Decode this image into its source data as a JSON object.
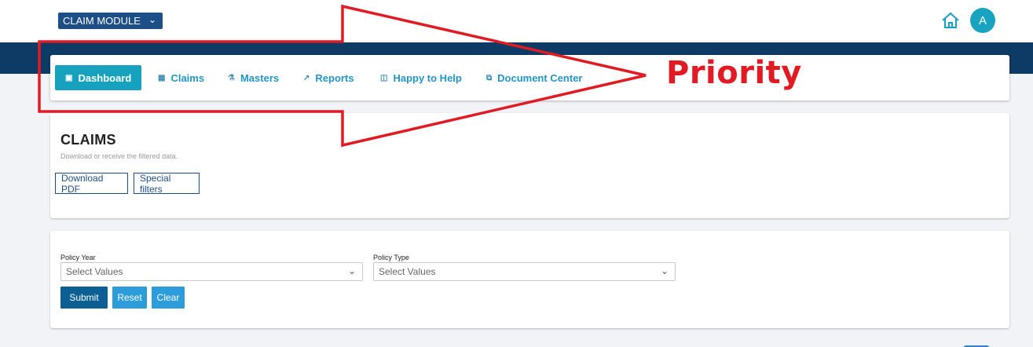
{
  "topbar": {
    "module_label": "CLAIM MODULE",
    "avatar_letter": "A"
  },
  "nav": {
    "tabs": [
      {
        "label": "Dashboard",
        "icon": "monitor-icon",
        "active": true
      },
      {
        "label": "Claims",
        "icon": "grid-icon",
        "active": false
      },
      {
        "label": "Masters",
        "icon": "sitemap-icon",
        "active": false
      },
      {
        "label": "Reports",
        "icon": "chart-line-icon",
        "active": false
      },
      {
        "label": "Happy to Help",
        "icon": "map-icon",
        "active": false
      },
      {
        "label": "Document Center",
        "icon": "copy-icon",
        "active": false
      }
    ]
  },
  "claims_panel": {
    "title": "CLAIMS",
    "subtitle": "Download or receive the filtered data.",
    "download_label": "Download PDF",
    "special_label": "Special filters"
  },
  "filters": {
    "policy_year_label": "Policy Year",
    "policy_year_value": "Select Values",
    "policy_type_label": "Policy Type",
    "policy_type_value": "Select Values",
    "submit_label": "Submit",
    "reset_label": "Reset",
    "clear_label": "Clear"
  },
  "annotation": {
    "text": "Priority",
    "color": "#e01b24"
  },
  "colors": {
    "brand_navy": "#0e3a66",
    "accent_teal": "#16a2bf",
    "link_blue": "#2196c9",
    "submit_blue": "#0b5f95",
    "secondary_blue": "#2d9cdb"
  }
}
